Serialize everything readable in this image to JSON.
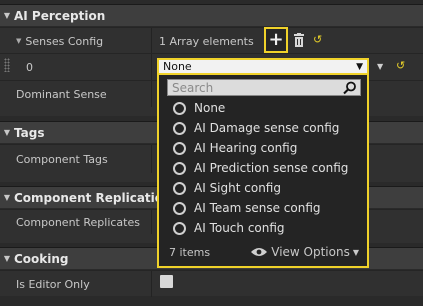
{
  "categories": {
    "ai_perception": "AI Perception",
    "tags": "Tags",
    "component_replication": "Component Replication",
    "cooking": "Cooking"
  },
  "rows": {
    "senses_config": {
      "label": "Senses Config",
      "value": "1 Array elements"
    },
    "index_zero": {
      "label": "0"
    },
    "dominant_sense": {
      "label": "Dominant Sense"
    },
    "component_tags": {
      "label": "Component Tags"
    },
    "component_replicates": {
      "label": "Component Replicates"
    },
    "is_editor_only": {
      "label": "Is Editor Only"
    }
  },
  "combo": {
    "selected": "None"
  },
  "dropdown": {
    "search_placeholder": "Search",
    "options": [
      "None",
      "AI Damage sense config",
      "AI Hearing config",
      "AI Prediction sense config",
      "AI Sight config",
      "AI Team sense config",
      "AI Touch config"
    ],
    "item_count": "7 items",
    "view_options": "View Options"
  },
  "icons": {
    "plus": "plus-icon",
    "trash": "trash-icon",
    "reset": "reset-arrow-icon",
    "search": "magnifier-icon",
    "eye": "eye-icon"
  },
  "colors": {
    "accent": "#f0d22a",
    "panel": "#2a2a2a",
    "header": "#3e3e3e"
  }
}
